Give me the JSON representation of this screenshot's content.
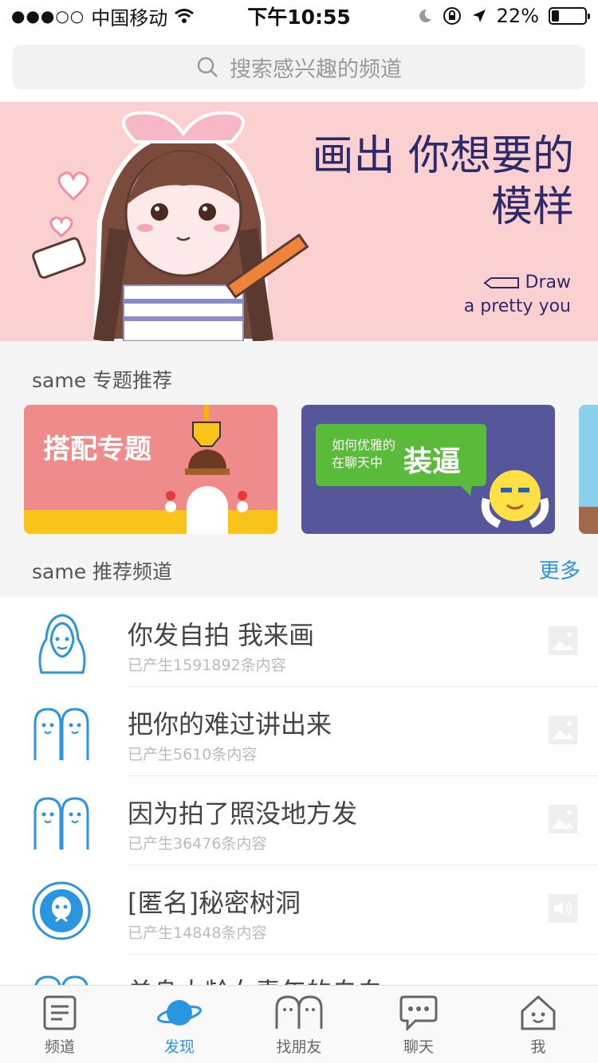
{
  "status_bar": {
    "carrier": "中国移动",
    "time": "下午10:55",
    "battery": "22%",
    "battery_level": 0.22
  },
  "search": {
    "placeholder": "搜索感兴趣的频道"
  },
  "banner": {
    "title_line1": "画出 你想要的",
    "title_line2": "模样",
    "en_line1": "Draw",
    "en_line2": "a pretty you"
  },
  "topics": {
    "title": "same 专题推荐",
    "cards": [
      {
        "label": "搭配专题"
      },
      {
        "label_small1": "如何优雅的",
        "label_small2": "在聊天中",
        "label_big": "装逼"
      }
    ]
  },
  "channels": {
    "title": "same 推荐频道",
    "more": "更多",
    "items": [
      {
        "title": "你发自拍 我来画",
        "count": "已产生1591892条内容",
        "icon": "portrait-icon",
        "kind": "image"
      },
      {
        "title": "把你的难过讲出来",
        "count": "已产生5610条内容",
        "icon": "same-ghost-icon",
        "kind": "image"
      },
      {
        "title": "因为拍了照没地方发",
        "count": "已产生36476条内容",
        "icon": "same-ghost-icon",
        "kind": "image"
      },
      {
        "title": "[匿名]秘密树洞",
        "count": "已产生14848条内容",
        "icon": "tree-hole-icon",
        "kind": "audio"
      },
      {
        "title": "单身大龄女青年的自白",
        "count": "",
        "icon": "same-ghost-icon",
        "kind": "image"
      }
    ]
  },
  "tabbar": {
    "items": [
      {
        "label": "频道",
        "icon": "channel-icon"
      },
      {
        "label": "发现",
        "icon": "planet-icon"
      },
      {
        "label": "找朋友",
        "icon": "friends-icon"
      },
      {
        "label": "聊天",
        "icon": "chat-icon"
      },
      {
        "label": "我",
        "icon": "home-face-icon"
      }
    ]
  },
  "colors": {
    "accent": "#2a95e0",
    "banner_bg": "#fbd0d0",
    "banner_text": "#2c2a6b",
    "card1_bg": "#f08b8b",
    "card2_bg": "#56579a"
  }
}
